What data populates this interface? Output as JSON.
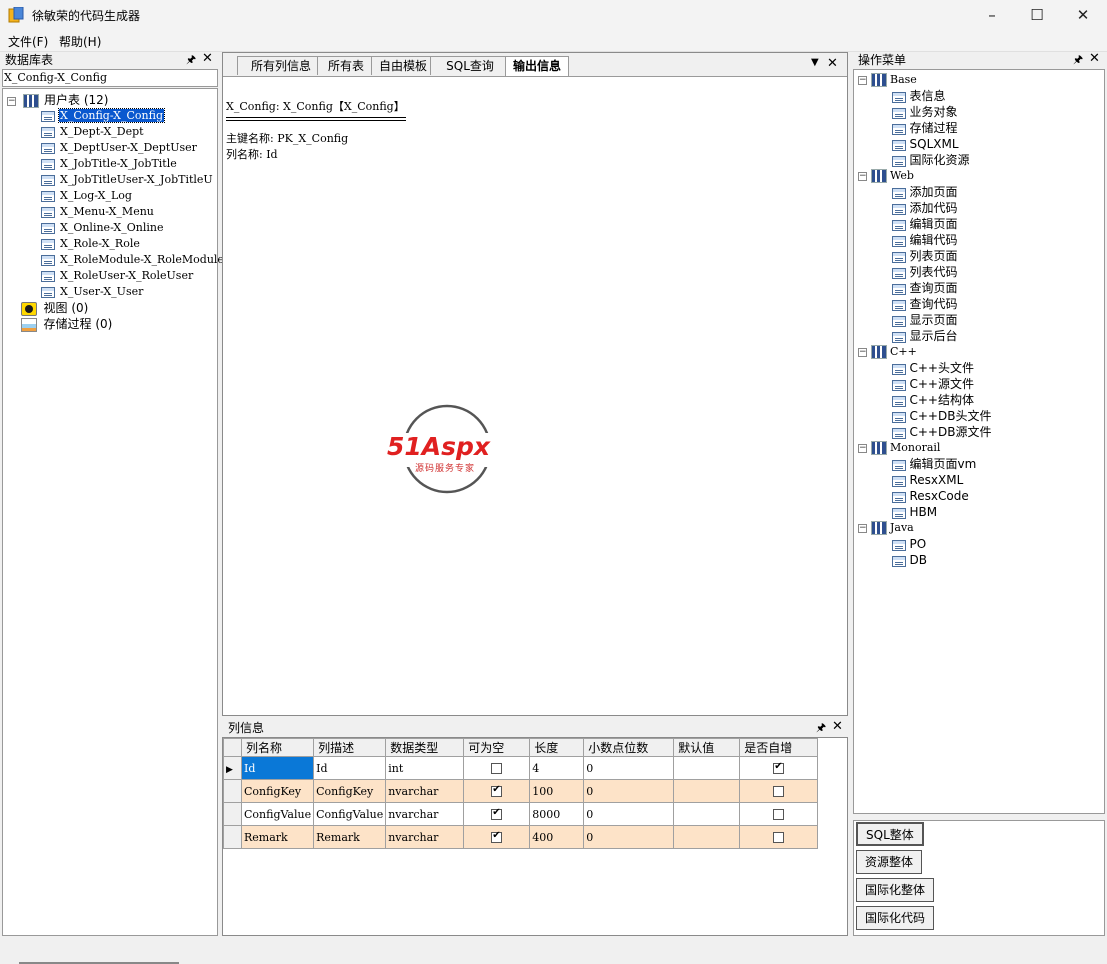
{
  "window": {
    "title": "徐敏荣的代码生成器"
  },
  "menu": [
    "文件(F)",
    "帮助(H)"
  ],
  "left_panel": {
    "title": "数据库表",
    "current": "X_Config-X_Config",
    "root_label": "用户表 (12)",
    "tables": [
      "X_Config-X_Config",
      "X_Dept-X_Dept",
      "X_DeptUser-X_DeptUser",
      "X_JobTitle-X_JobTitle",
      "X_JobTitleUser-X_JobTitleU",
      "X_Log-X_Log",
      "X_Menu-X_Menu",
      "X_Online-X_Online",
      "X_Role-X_Role",
      "X_RoleModule-X_RoleModule",
      "X_RoleUser-X_RoleUser",
      "X_User-X_User"
    ],
    "views_label": "视图 (0)",
    "procs_label": "存储过程 (0)"
  },
  "tabs": [
    "所有列信息",
    "所有表",
    "自由模板",
    "SQL查询",
    "输出信息"
  ],
  "output": {
    "line1": "X_Config: X_Config【X_Config】",
    "line2": "主键名称: PK_X_Config",
    "line3": "列名称: Id"
  },
  "watermark": {
    "brand": "51Aspx",
    "tagline": "源码服务专家"
  },
  "columns_panel": {
    "title": "列信息",
    "headers": [
      "列名称",
      "列描述",
      "数据类型",
      "可为空",
      "长度",
      "小数点位数",
      "默认值",
      "是否自增"
    ],
    "rows": [
      {
        "name": "Id",
        "desc": "Id",
        "type": "int",
        "nullable": false,
        "length": "4",
        "scale": "0",
        "default": "",
        "identity": true
      },
      {
        "name": "ConfigKey",
        "desc": "ConfigKey",
        "type": "nvarchar",
        "nullable": true,
        "length": "100",
        "scale": "0",
        "default": "",
        "identity": false
      },
      {
        "name": "ConfigValue",
        "desc": "ConfigValue",
        "type": "nvarchar",
        "nullable": true,
        "length": "8000",
        "scale": "0",
        "default": "",
        "identity": false
      },
      {
        "name": "Remark",
        "desc": "Remark",
        "type": "nvarchar",
        "nullable": true,
        "length": "400",
        "scale": "0",
        "default": "",
        "identity": false
      }
    ]
  },
  "right_panel": {
    "title": "操作菜单",
    "groups": [
      {
        "label": "Base",
        "items": [
          "表信息",
          "业务对象",
          "存储过程",
          "SQLXML",
          "国际化资源"
        ]
      },
      {
        "label": "Web",
        "items": [
          "添加页面",
          "添加代码",
          "编辑页面",
          "编辑代码",
          "列表页面",
          "列表代码",
          "查询页面",
          "查询代码",
          "显示页面",
          "显示后台"
        ]
      },
      {
        "label": "C++",
        "items": [
          "C++头文件",
          "C++源文件",
          "C++结构体",
          "C++DB头文件",
          "C++DB源文件"
        ]
      },
      {
        "label": "Monorail",
        "items": [
          "编辑页面vm",
          "ResxXML",
          "ResxCode",
          "HBM"
        ]
      },
      {
        "label": "Java",
        "items": [
          "PO",
          "DB"
        ]
      }
    ],
    "buttons": [
      "SQL整体",
      "资源整体",
      "国际化整体",
      "国际化代码"
    ]
  },
  "colors": {
    "selection": "#0a58cf",
    "alt_row": "#fde3c8"
  }
}
